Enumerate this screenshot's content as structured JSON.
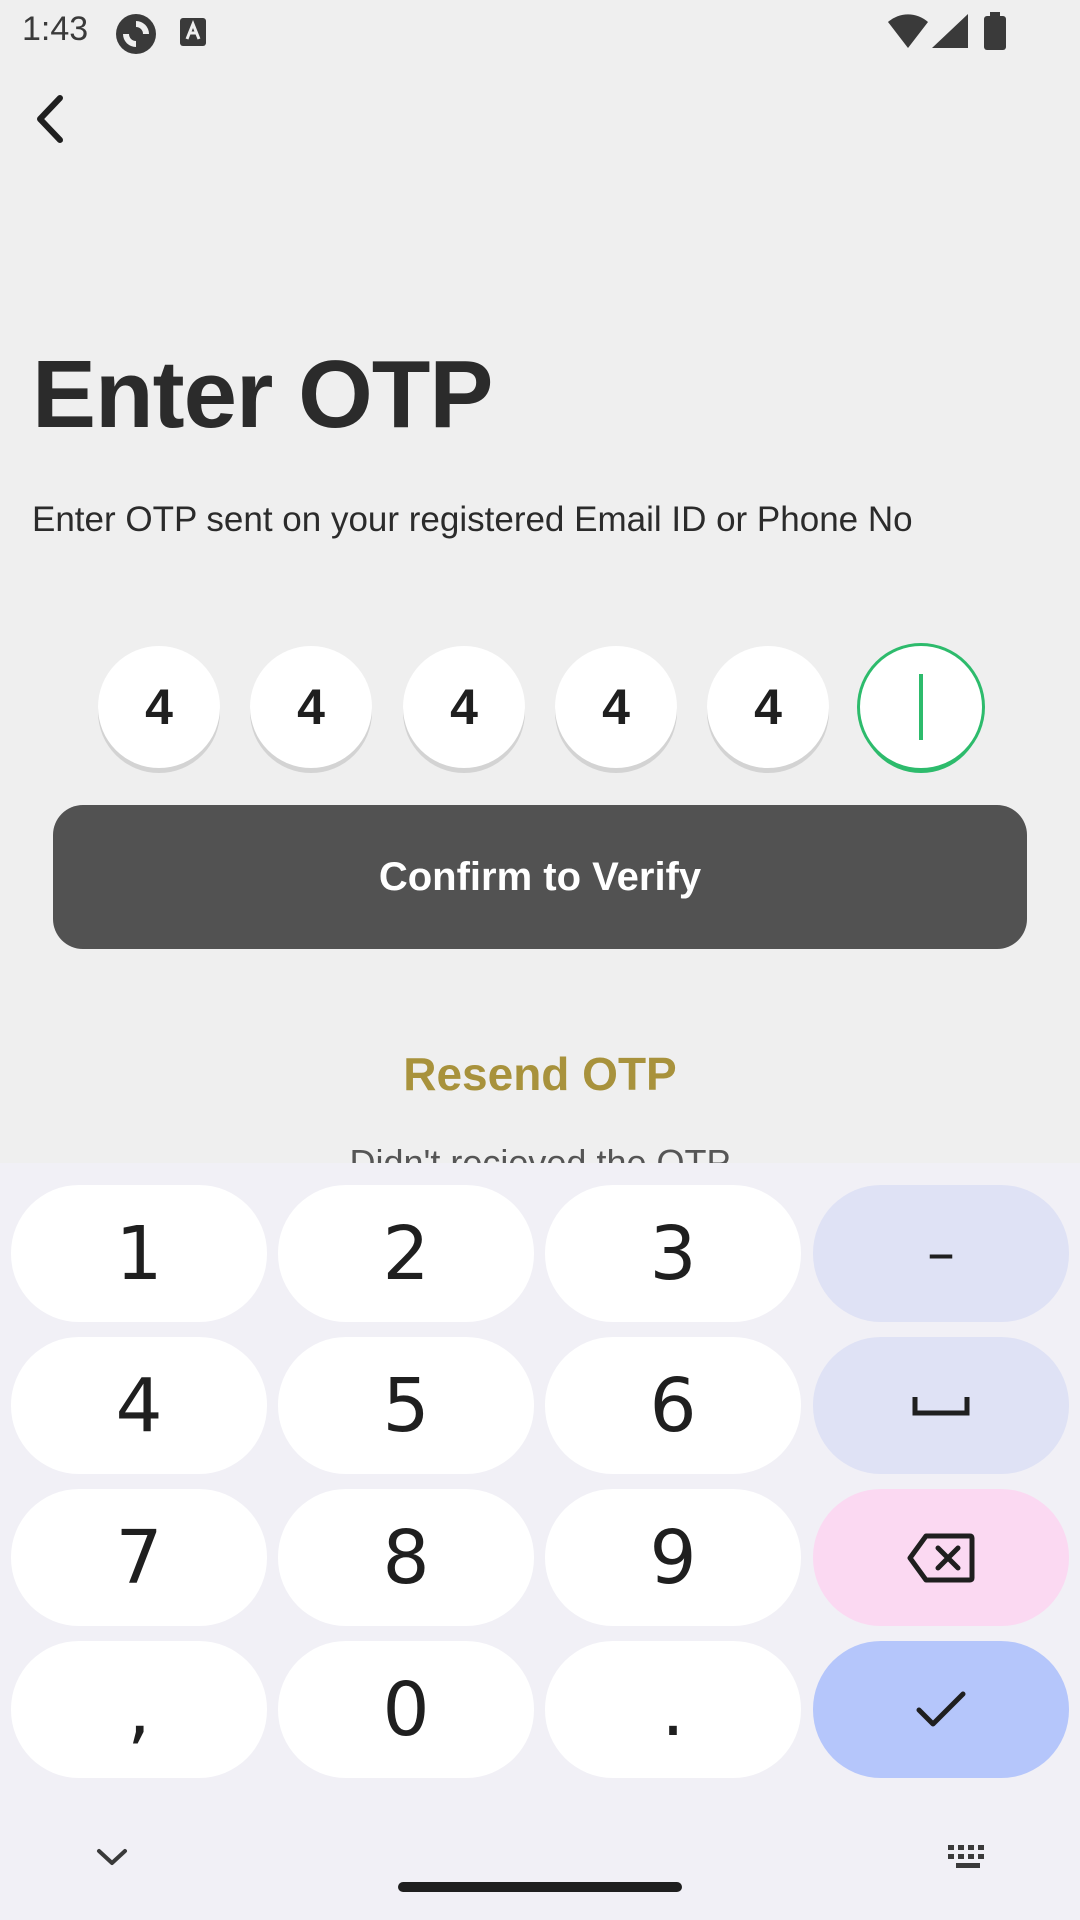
{
  "status_bar": {
    "time": "1:43",
    "icons": [
      "sync-icon",
      "font-icon",
      "wifi-icon",
      "signal-icon",
      "battery-icon"
    ]
  },
  "header": {
    "back_icon": "chevron-left-icon"
  },
  "main": {
    "title": "Enter OTP",
    "subtitle": "Enter OTP sent on your registered Email ID or Phone No",
    "otp_digits": [
      "4",
      "4",
      "4",
      "4",
      "4",
      ""
    ],
    "active_digit_index": 5,
    "confirm_label": "Confirm to Verify",
    "resend_label": "Resend OTP",
    "hint": "Didn't recieved the OTP"
  },
  "keyboard": {
    "rows": [
      [
        "1",
        "2",
        "3",
        "–"
      ],
      [
        "4",
        "5",
        "6",
        "space"
      ],
      [
        "7",
        "8",
        "9",
        "backspace"
      ],
      [
        ",",
        "0",
        ".",
        "done"
      ]
    ],
    "keys": {
      "k1": "1",
      "k2": "2",
      "k3": "3",
      "minus": "–",
      "k4": "4",
      "k5": "5",
      "k6": "6",
      "k7": "7",
      "k8": "8",
      "k9": "9",
      "comma": ",",
      "k0": "0",
      "period": "."
    },
    "icons": [
      "space-icon",
      "backspace-icon",
      "check-icon",
      "chevron-down-icon",
      "keyboard-icon"
    ]
  },
  "colors": {
    "background": "#efefef",
    "accent_green": "#2dbb6c",
    "resend_gold": "#a8923c",
    "confirm_button": "#525252",
    "key_function": "#dfe2f5",
    "key_delete": "#fbd9f2",
    "key_done": "#b5c6fb"
  }
}
